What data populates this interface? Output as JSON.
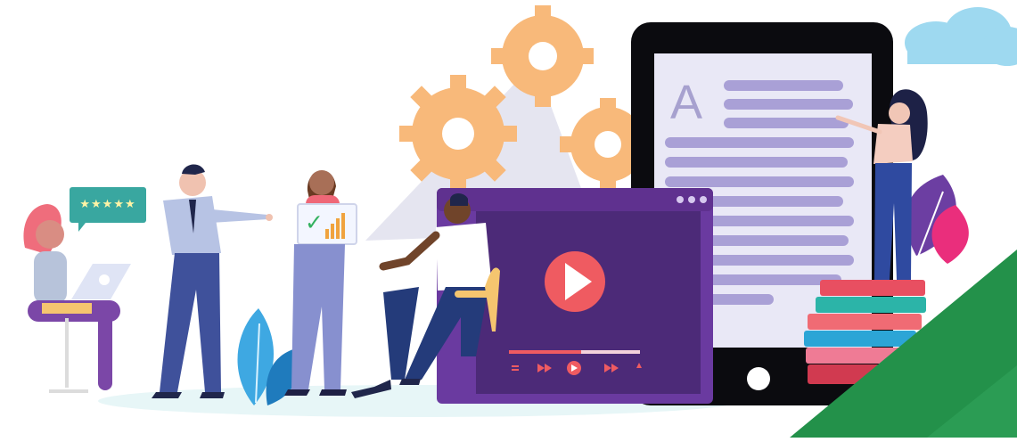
{
  "scene": {
    "description_labels": {
      "rating": "★★★★★",
      "document_initial": "A",
      "chart_check": "✓"
    },
    "icons": [
      "gear-icon",
      "cloud-icon",
      "play-icon",
      "star-icon",
      "check-icon",
      "leaf-icon",
      "book-icon"
    ],
    "colors": {
      "gear": "#f8b97a",
      "video_purple": "#6a3aa0",
      "play_button": "#ef5b61",
      "tablet_frame": "#0b0b0f",
      "tablet_screen": "#e9e8f6",
      "lines": "#a9a0d6",
      "cloud": "#9ed9f0",
      "green_corner": "#23914a"
    }
  }
}
